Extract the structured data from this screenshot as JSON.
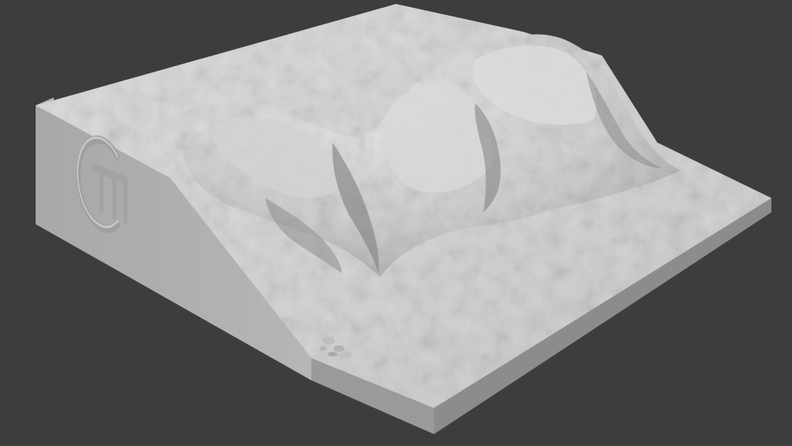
{
  "viewport": {
    "background_color": "#3d3d3d"
  },
  "model": {
    "base_color": "#c9c9c9",
    "top_color": "#d6d6d6",
    "side_left_color": "#b8b8b8",
    "front_edge_color": "#9e9e9e",
    "rock_highlight_color": "#e2e2e2",
    "rock_shadow_color": "#8e8e8e"
  },
  "logo": {
    "icon": "embossed-circle-logo"
  }
}
